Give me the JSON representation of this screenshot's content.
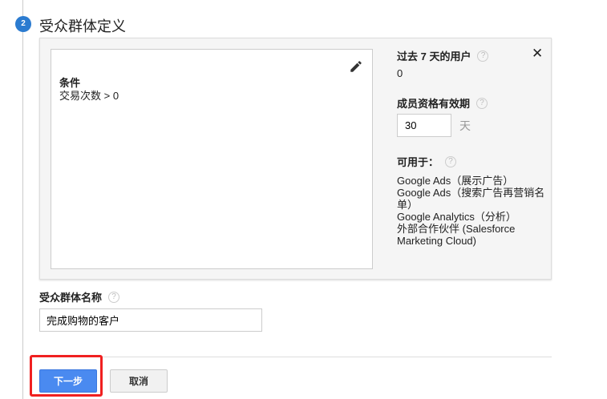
{
  "step_number": "2",
  "section_title": "受众群体定义",
  "condition": {
    "heading": "条件",
    "value": "交易次数 > 0"
  },
  "users_last_7_days": {
    "label": "过去 7 天的用户",
    "value": "0"
  },
  "membership_duration": {
    "label": "成员资格有效期",
    "value": "30",
    "unit": "天"
  },
  "available_for": {
    "label": "可用于：",
    "items": [
      "Google Ads（展示广告）",
      "Google Ads（搜索广告再营销名单）",
      "Google Analytics（分析）",
      "外部合作伙伴 (Salesforce Marketing Cloud)"
    ]
  },
  "audience_name": {
    "label": "受众群体名称",
    "value": "完成购物的客户"
  },
  "help_glyph": "?",
  "close_glyph": "✕",
  "buttons": {
    "next": "下一步",
    "cancel": "取消"
  },
  "colors": {
    "accent": "#4a8af0",
    "step": "#2b7bd0",
    "highlight": "#f02020"
  }
}
